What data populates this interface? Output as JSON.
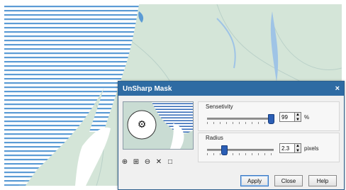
{
  "dialog": {
    "title": "UnSharp Mask",
    "close_glyph": "×"
  },
  "preview_tools": [
    {
      "icon": "zoom-in-icon",
      "glyph": "⊕"
    },
    {
      "icon": "fit-icon",
      "glyph": "⊞"
    },
    {
      "icon": "zoom-out-icon",
      "glyph": "⊖"
    },
    {
      "icon": "cross-icon",
      "glyph": "✕"
    },
    {
      "icon": "square-icon",
      "glyph": "□"
    }
  ],
  "sensitivity": {
    "label": "Sensetivity",
    "value": "99",
    "unit": "%",
    "level": 0.99
  },
  "radius": {
    "label": "Radius",
    "value": "2.3",
    "unit": "pixels",
    "level": 0.23
  },
  "buttons": {
    "apply": "Apply",
    "close": "Close",
    "help": "Help"
  },
  "colors": {
    "titlebar": "#2e6ba3",
    "map_green": "#d4e5d8",
    "map_water": "#5b9bd5"
  }
}
